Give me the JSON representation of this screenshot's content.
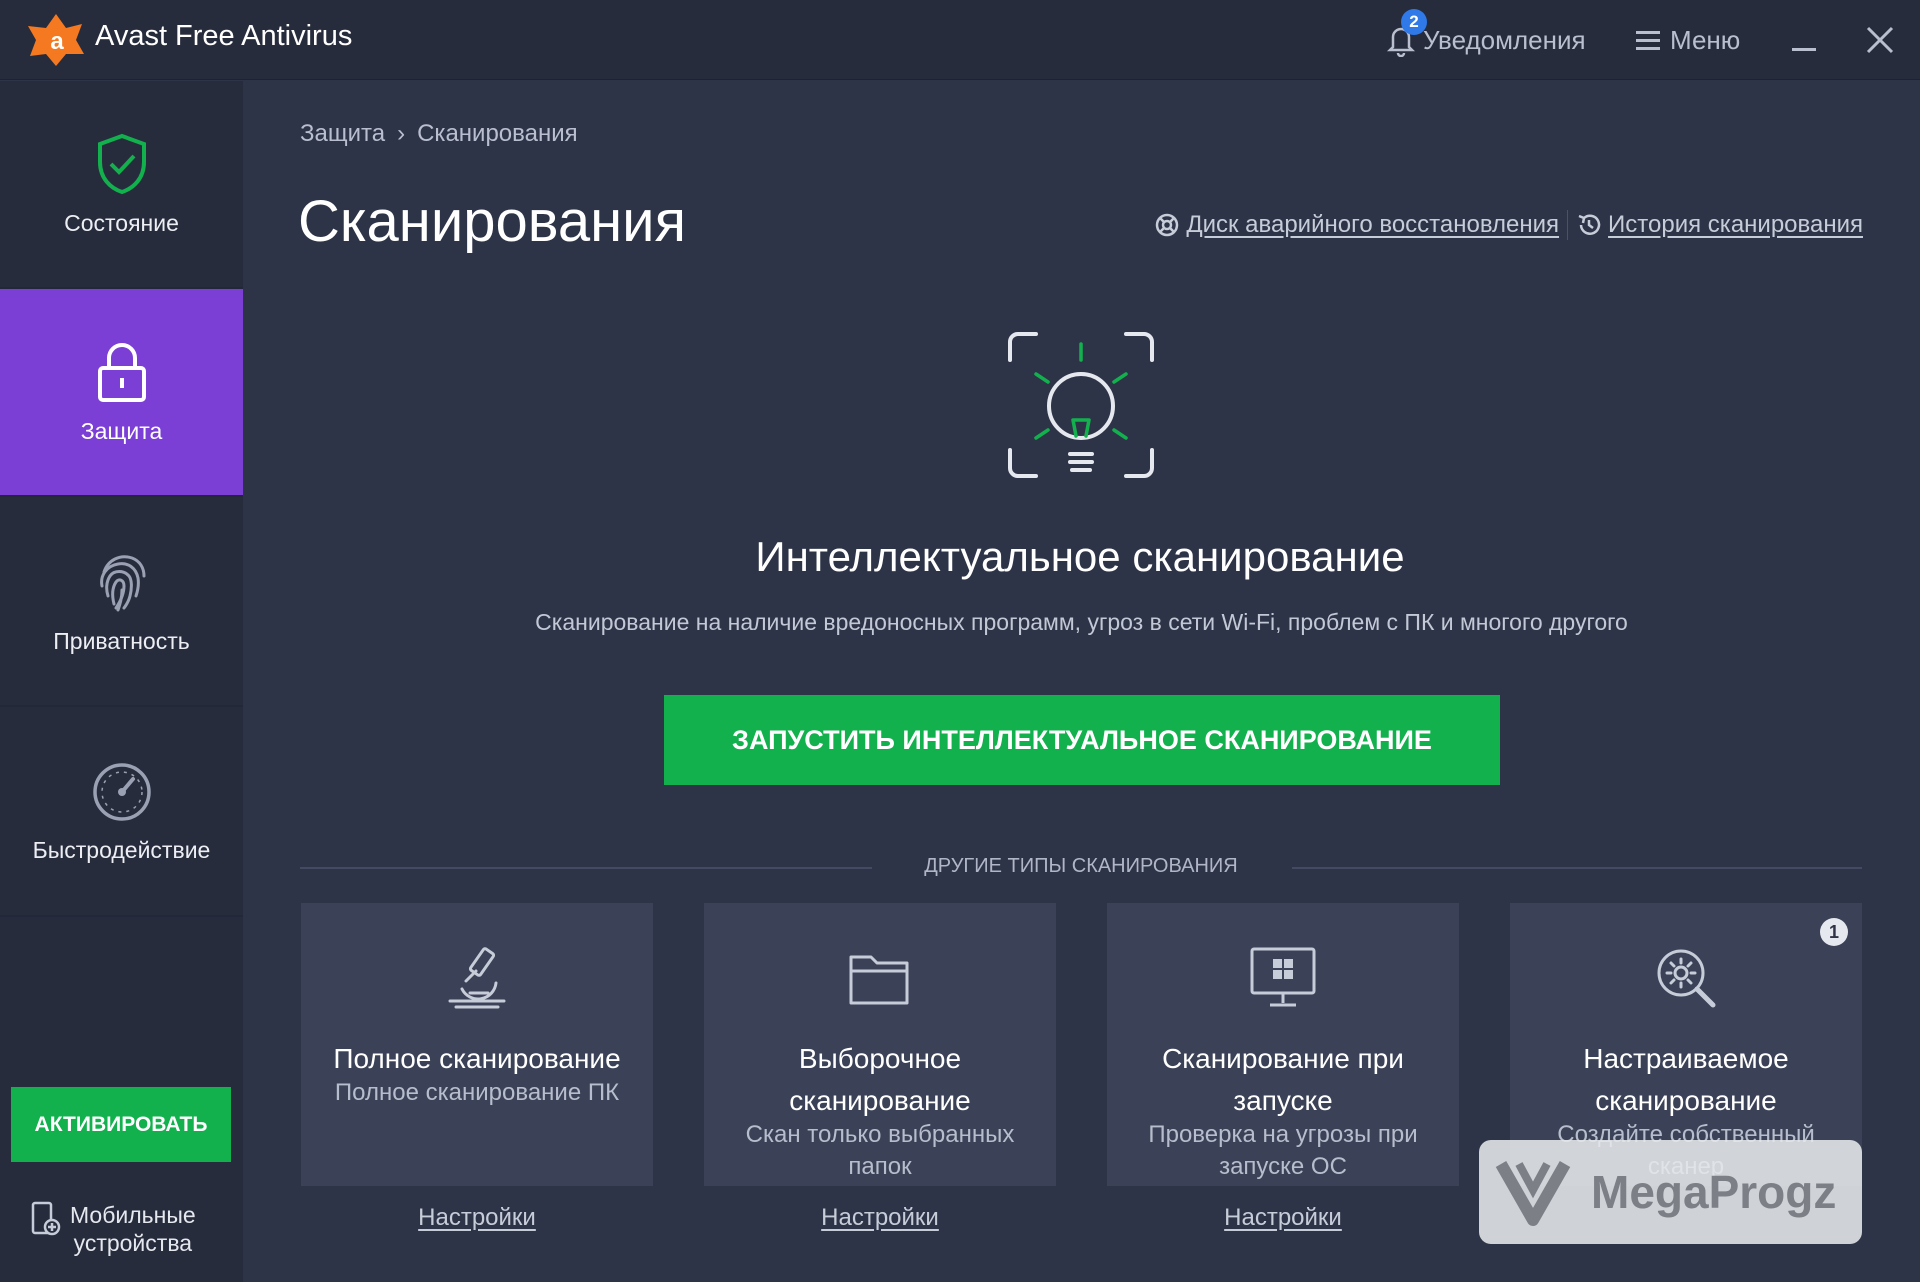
{
  "app": {
    "title": "Avast Free Antivirus",
    "brand_color": "#f47920"
  },
  "titlebar": {
    "notifications_label": "Уведомления",
    "notifications_count": "2",
    "menu_label": "Меню"
  },
  "sidebar": {
    "items": [
      {
        "label": "Состояние",
        "icon": "shield-check-icon"
      },
      {
        "label": "Защита",
        "icon": "lock-icon",
        "active": true
      },
      {
        "label": "Приватность",
        "icon": "fingerprint-icon"
      },
      {
        "label": "Быстродействие",
        "icon": "speedometer-icon"
      }
    ],
    "activate_label": "АКТИВИРОВАТЬ",
    "mobile_line1": "Мобильные",
    "mobile_line2": "устройства"
  },
  "breadcrumb": {
    "parent": "Защита",
    "separator": "›",
    "current": "Сканирования"
  },
  "page": {
    "title": "Сканирования",
    "link_rescue": "Диск аварийного восстановления",
    "link_history": "История сканирования"
  },
  "hero": {
    "title": "Интеллектуальное сканирование",
    "subtitle": "Сканирование на наличие вредоносных программ, угроз в сети Wi-Fi, проблем с ПК и многого другого",
    "button": "ЗАПУСТИТЬ ИНТЕЛЛЕКТУАЛЬНОЕ СКАНИРОВАНИЕ"
  },
  "other_scans": {
    "label": "ДРУГИЕ ТИПЫ СКАНИРОВАНИЯ",
    "cards": [
      {
        "title": "Полное сканирование",
        "desc": "Полное сканирование ПК",
        "settings": "Настройки",
        "icon": "microscope-icon"
      },
      {
        "title": "Выборочное сканирование",
        "desc": "Скан только выбранных папок",
        "settings": "Настройки",
        "icon": "folder-icon"
      },
      {
        "title": "Сканирование при запуске",
        "desc": "Проверка на угрозы при запуске ОС",
        "settings": "Настройки",
        "icon": "monitor-icon"
      },
      {
        "title": "Настраиваемое сканирование",
        "desc": "Создайте собственный сканер",
        "badge": "1",
        "icon": "gear-magnifier-icon"
      }
    ]
  },
  "watermark": {
    "text": "MegaProgz"
  },
  "colors": {
    "accent_green": "#12b14d",
    "active_purple": "#7b3fd6",
    "background": "#2e3447"
  }
}
